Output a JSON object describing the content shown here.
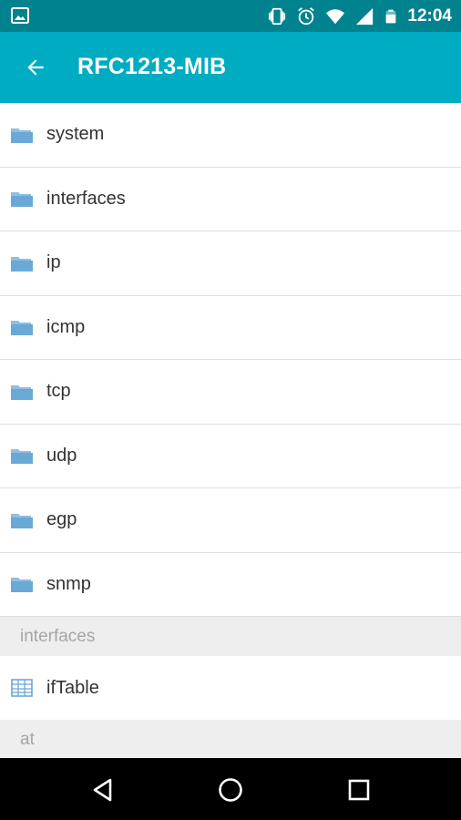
{
  "status_bar": {
    "time": "12:04",
    "icons": [
      "image-icon",
      "vibrate-icon",
      "alarm-icon",
      "wifi-icon",
      "signal-icon",
      "battery-icon"
    ]
  },
  "app_bar": {
    "title": "RFC1213-MIB",
    "back_icon": "arrow-back-icon",
    "background": "#00acc1",
    "status_background": "#00838f"
  },
  "folders": [
    {
      "label": "system",
      "icon": "folder-icon"
    },
    {
      "label": "interfaces",
      "icon": "folder-icon"
    },
    {
      "label": "ip",
      "icon": "folder-icon"
    },
    {
      "label": "icmp",
      "icon": "folder-icon"
    },
    {
      "label": "tcp",
      "icon": "folder-icon"
    },
    {
      "label": "udp",
      "icon": "folder-icon"
    },
    {
      "label": "egp",
      "icon": "folder-icon"
    },
    {
      "label": "snmp",
      "icon": "folder-icon"
    }
  ],
  "sections": [
    {
      "header": "interfaces",
      "items": [
        {
          "label": "ifTable",
          "icon": "table-icon"
        }
      ]
    },
    {
      "header": "at",
      "items": []
    }
  ],
  "nav_bar": {
    "icons": [
      "back-triangle-icon",
      "home-circle-icon",
      "recents-square-icon"
    ]
  }
}
